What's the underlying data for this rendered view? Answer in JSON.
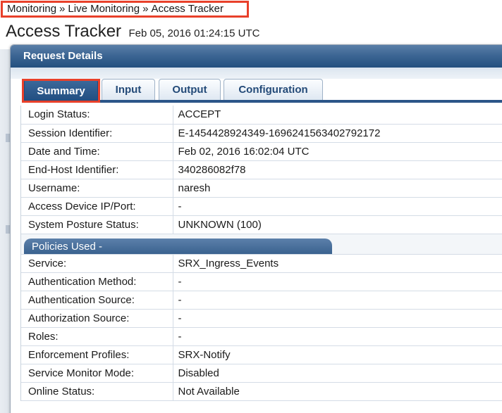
{
  "breadcrumb": {
    "items": [
      "Monitoring",
      "Live Monitoring",
      "Access Tracker"
    ],
    "separator": "»"
  },
  "page": {
    "title": "Access Tracker",
    "timestamp": "Feb 05, 2016 01:24:15 UTC"
  },
  "dialog": {
    "title": "Request Details"
  },
  "tabs": [
    {
      "label": "Summary",
      "active": true
    },
    {
      "label": "Input",
      "active": false
    },
    {
      "label": "Output",
      "active": false
    },
    {
      "label": "Configuration",
      "active": false
    }
  ],
  "summary": [
    {
      "key": "Login Status:",
      "value": "ACCEPT"
    },
    {
      "key": "Session Identifier:",
      "value": "E-1454428924349-1696241563402792172"
    },
    {
      "key": "Date and Time:",
      "value": "Feb 02, 2016 16:02:04 UTC"
    },
    {
      "key": "End-Host Identifier:",
      "value": "340286082f78"
    },
    {
      "key": "Username:",
      "value": "naresh"
    },
    {
      "key": "Access Device IP/Port:",
      "value": "-"
    },
    {
      "key": "System Posture Status:",
      "value": "UNKNOWN (100)"
    }
  ],
  "policies_section": {
    "title": "Policies Used -"
  },
  "policies": [
    {
      "key": "Service:",
      "value": "SRX_Ingress_Events"
    },
    {
      "key": "Authentication Method:",
      "value": "-"
    },
    {
      "key": "Authentication Source:",
      "value": "-"
    },
    {
      "key": "Authorization Source:",
      "value": "-"
    },
    {
      "key": "Roles:",
      "value": "-"
    },
    {
      "key": "Enforcement Profiles:",
      "value": "SRX-Notify"
    },
    {
      "key": "Service Monitor Mode:",
      "value": "Disabled"
    },
    {
      "key": "Online Status:",
      "value": "Not Available"
    }
  ],
  "colors": {
    "highlight": "#e8402a",
    "header_blue": "#23507f",
    "tab_text": "#234a78"
  }
}
